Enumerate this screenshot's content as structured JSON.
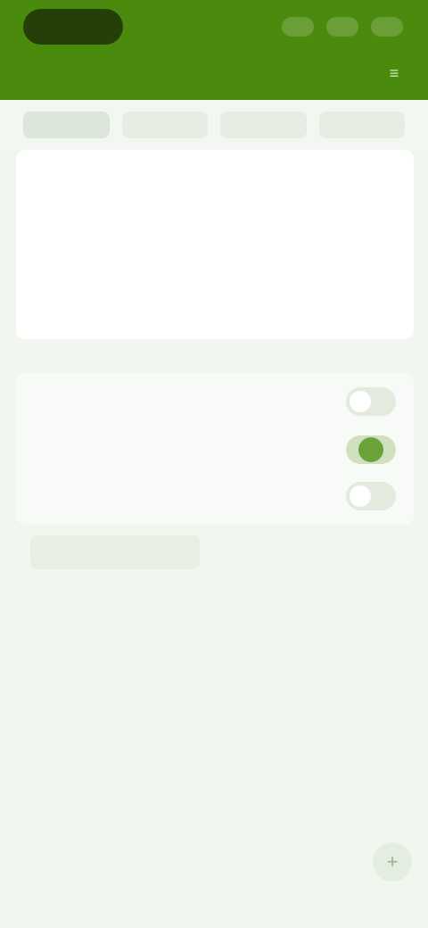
{
  "header": {
    "logo_text": "",
    "chips": [
      "",
      "",
      ""
    ],
    "center_link": "",
    "menu_icon": "menu-icon"
  },
  "tabs": [
    {
      "label": ""
    },
    {
      "label": ""
    },
    {
      "label": ""
    },
    {
      "label": ""
    }
  ],
  "note": {
    "label": "",
    "placeholder": "",
    "value": ""
  },
  "settings": {
    "rows": [
      {
        "label": "",
        "enabled": false
      },
      {
        "label": "",
        "enabled": true
      },
      {
        "label": "",
        "enabled": false
      }
    ]
  },
  "actions": {
    "link_label": "",
    "footnote": ""
  },
  "fab": {
    "icon": "plus-icon",
    "glyph": "+"
  },
  "colors": {
    "header_bg": "#4a8a0c",
    "logo_bg": "#243f08",
    "page_bg": "#f1f6ef",
    "accent": "#6aa33a"
  }
}
